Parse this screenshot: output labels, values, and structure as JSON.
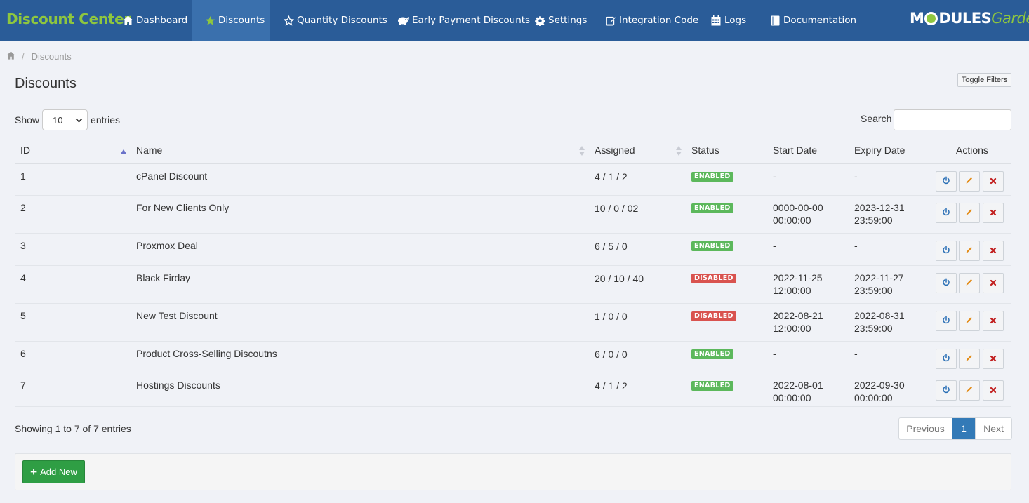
{
  "nav": {
    "brand": "Discount Center",
    "items": [
      {
        "label": "Dashboard",
        "icon": "home-icon"
      },
      {
        "label": "Discounts",
        "icon": "star-icon",
        "active": true
      },
      {
        "label": "Quantity Discounts",
        "icon": "star-outline-icon"
      },
      {
        "label": "Early Payment Discounts",
        "icon": "piggy-bank-icon"
      },
      {
        "label": "Settings",
        "icon": "gear-icon"
      },
      {
        "label": "Integration Code",
        "icon": "edit-icon"
      },
      {
        "label": "Logs",
        "icon": "calendar-icon"
      },
      {
        "label": "Documentation",
        "icon": "book-icon"
      }
    ],
    "logo_part1": "M",
    "logo_part2": "DULES",
    "logo_part3": "Garden"
  },
  "breadcrumb": {
    "separator": "/",
    "current": "Discounts"
  },
  "page": {
    "title": "Discounts",
    "toggle_filters": "Toggle Filters"
  },
  "table_controls": {
    "show_label": "Show",
    "entries_value": "10",
    "entries_label": "entries",
    "search_label": "Search",
    "search_value": ""
  },
  "table": {
    "columns": [
      "ID",
      "Name",
      "Assigned",
      "Status",
      "Start Date",
      "Expiry Date",
      "Actions"
    ],
    "rows": [
      {
        "id": "1",
        "name": "cPanel Discount",
        "assigned": "4 / 1 / 2",
        "status": "ENABLED",
        "start1": "-",
        "start2": "",
        "exp1": "-",
        "exp2": ""
      },
      {
        "id": "2",
        "name": "For New Clients Only",
        "assigned": "10 / 0 / 02",
        "status": "ENABLED",
        "start1": "0000-00-00",
        "start2": "00:00:00",
        "exp1": "2023-12-31",
        "exp2": "23:59:00"
      },
      {
        "id": "3",
        "name": "Proxmox Deal",
        "assigned": "6 / 5 / 0",
        "status": "ENABLED",
        "start1": "-",
        "start2": "",
        "exp1": "-",
        "exp2": ""
      },
      {
        "id": "4",
        "name": "Black Firday",
        "assigned": "20 / 10 / 40",
        "status": "DISABLED",
        "start1": "2022-11-25",
        "start2": "12:00:00",
        "exp1": "2022-11-27",
        "exp2": "23:59:00"
      },
      {
        "id": "5",
        "name": "New Test Discount",
        "assigned": "1 / 0 / 0",
        "status": "DISABLED",
        "start1": "2022-08-21",
        "start2": "12:00:00",
        "exp1": "2022-08-31",
        "exp2": "23:59:00"
      },
      {
        "id": "6",
        "name": "Product Cross-Selling Discoutns",
        "assigned": "6 / 0 / 0",
        "status": "ENABLED",
        "start1": "-",
        "start2": "",
        "exp1": "-",
        "exp2": ""
      },
      {
        "id": "7",
        "name": "Hostings Discounts",
        "assigned": "4 / 1 / 2",
        "status": "ENABLED",
        "start1": "2022-08-01",
        "start2": "00:00:00",
        "exp1": "2022-09-30",
        "exp2": "00:00:00"
      }
    ]
  },
  "footer": {
    "showing": "Showing 1 to 7 of 7 entries",
    "prev": "Previous",
    "page": "1",
    "next": "Next",
    "add_new": "Add New"
  },
  "colors": {
    "nav_bg": "#2a5c98",
    "brand": "#8ec63f",
    "enabled": "#5cb85c",
    "disabled": "#d9534f",
    "primary": "#337ab7",
    "success": "#2f9e44"
  }
}
